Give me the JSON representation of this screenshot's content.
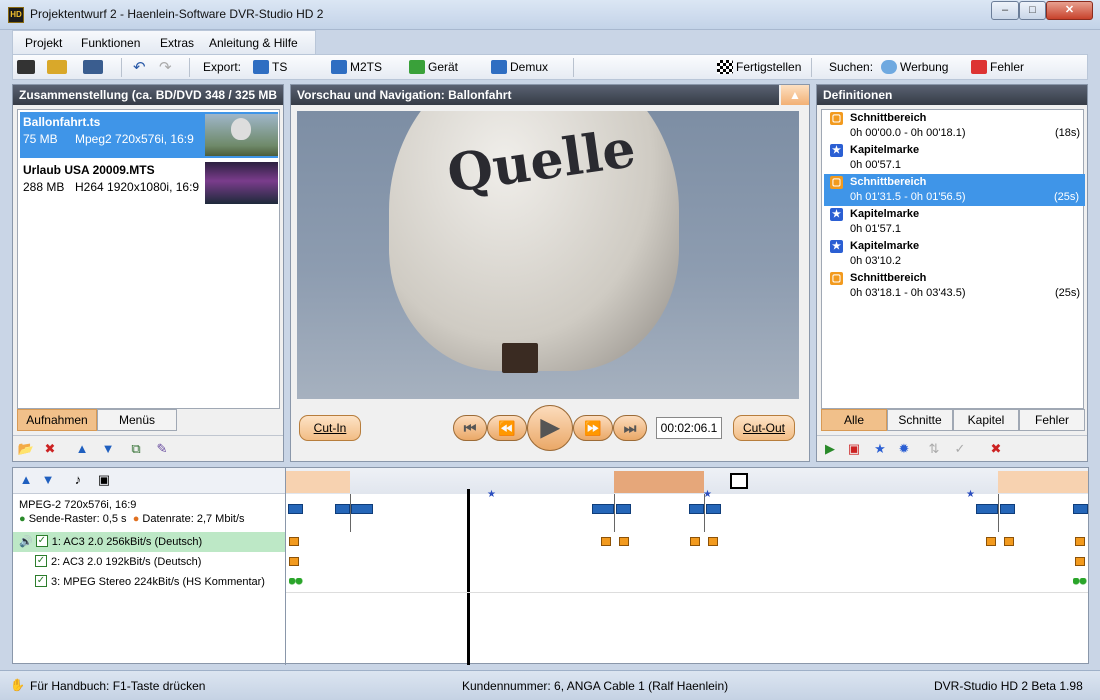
{
  "window": {
    "title": "Projektentwurf 2 - Haenlein-Software DVR-Studio HD 2",
    "icon_text": "HD"
  },
  "menu": {
    "items": [
      "Projekt",
      "Funktionen",
      "Extras",
      "Anleitung & Hilfe"
    ]
  },
  "toolbar": {
    "export_label": "Export:",
    "ts_label": "TS",
    "m2ts_label": "M2TS",
    "geraet_label": "Gerät",
    "demux_label": "Demux",
    "finish_label": "Fertigstellen",
    "search_label": "Suchen:",
    "ads_label": "Werbung",
    "errors_label": "Fehler"
  },
  "compilation": {
    "header": "Zusammenstellung (ca.  BD/DVD 348 /  325 MB",
    "files": [
      {
        "name": "Ballonfahrt.ts",
        "size": "75 MB",
        "info": "Mpeg2 720x576i, 16:9",
        "selected": true
      },
      {
        "name": "Urlaub USA 20009.MTS",
        "size": "288 MB",
        "info": "H264 1920x1080i, 16:9",
        "selected": false
      }
    ],
    "tabs": [
      "Aufnahmen",
      "Menüs"
    ],
    "active_tab": "Aufnahmen"
  },
  "preview": {
    "header": "Vorschau und Navigation: Ballonfahrt",
    "cut_in": "Cut-In",
    "cut_out": "Cut-Out",
    "timecode": "00:02:06.1",
    "balloon_text": "Quelle"
  },
  "definitions": {
    "header": "Definitionen",
    "items": [
      {
        "type": "Schnittbereich",
        "time": "0h 00'00.0 - 0h 00'18.1)",
        "duration": "(18s)",
        "selected": false
      },
      {
        "type": "Kapitelmarke",
        "time": "0h 00'57.1",
        "duration": "",
        "selected": false
      },
      {
        "type": "Schnittbereich",
        "time": "0h 01'31.5 - 0h 01'56.5)",
        "duration": "(25s)",
        "selected": true
      },
      {
        "type": "Kapitelmarke",
        "time": "0h 01'57.1",
        "duration": "",
        "selected": false
      },
      {
        "type": "Kapitelmarke",
        "time": "0h 03'10.2",
        "duration": "",
        "selected": false
      },
      {
        "type": "Schnittbereich",
        "time": "0h 03'18.1 - 0h 03'43.5)",
        "duration": "(25s)",
        "selected": false
      }
    ],
    "tabs": [
      "Alle",
      "Schnitte",
      "Kapitel",
      "Fehler"
    ],
    "active_tab": "Alle"
  },
  "timeline": {
    "video_track": "MPEG-2 720x576i, 16:9",
    "send_raster": "Sende-Raster: 0,5 s",
    "datarate": "Datenrate: 2,7 Mbit/s",
    "audio_tracks": [
      {
        "label": "1: AC3 2.0 256kBit/s (Deutsch)",
        "checked": true,
        "active": true
      },
      {
        "label": "2: AC3 2.0 192kBit/s (Deutsch)",
        "checked": true,
        "active": false
      },
      {
        "label": "3: MPEG Stereo 224kBit/s (HS Kommentar)",
        "checked": true,
        "active": false
      }
    ]
  },
  "statusbar": {
    "help": "Für Handbuch: F1-Taste drücken",
    "customer": "Kundennummer: 6, ANGA Cable 1 (Ralf Haenlein)",
    "version": "DVR-Studio HD 2 Beta 1.98"
  },
  "colors": {
    "accent": "#3f95e8",
    "cut_range": "#f29a1e",
    "header_dark": "#404652"
  }
}
